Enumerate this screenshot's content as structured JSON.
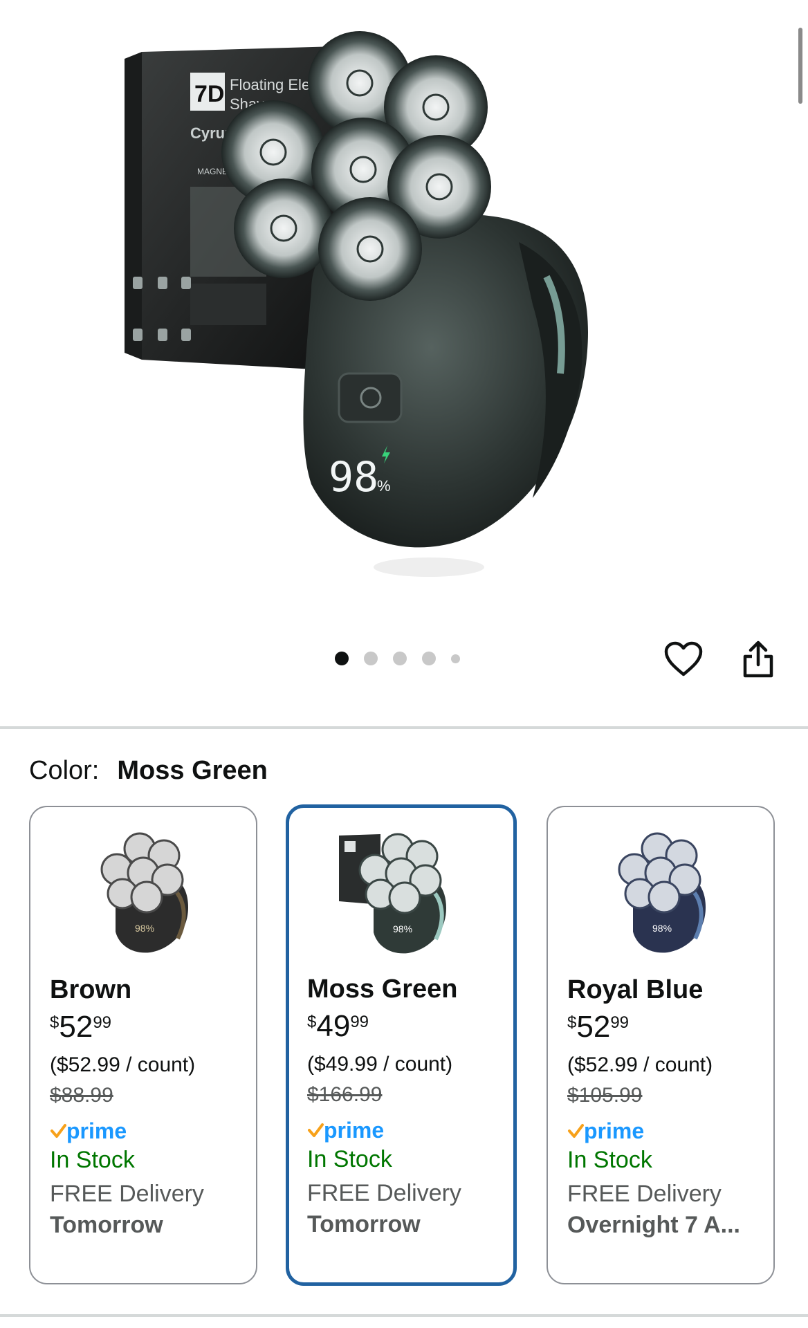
{
  "gallery": {
    "image_count": 5,
    "active_index": 0,
    "product_box_text": "7D Floating Electric Shaver",
    "brand": "Cyruzi",
    "box_feature": "MAGNETIC HEAD",
    "display_readout": "98%"
  },
  "actions": {
    "wishlist_icon": "heart-icon",
    "share_icon": "share-icon"
  },
  "color_selector": {
    "label": "Color:",
    "selected": "Moss Green"
  },
  "variants": [
    {
      "name": "Brown",
      "price_symbol": "$",
      "price_whole": "52",
      "price_fraction": "99",
      "unit_price": "($52.99 / count)",
      "list_price": "$88.99",
      "prime": "prime",
      "availability": "In Stock",
      "delivery": "FREE Delivery",
      "delivery_date": "Tomorrow",
      "body_color": "#2c2c2c",
      "accent_color": "#6b5a3e"
    },
    {
      "name": "Moss Green",
      "price_symbol": "$",
      "price_whole": "49",
      "price_fraction": "99",
      "unit_price": "($49.99 / count)",
      "list_price": "$166.99",
      "prime": "prime",
      "availability": "In Stock",
      "delivery": "FREE Delivery",
      "delivery_date": "Tomorrow",
      "body_color": "#2f3a37",
      "accent_color": "#9cc9c0"
    },
    {
      "name": "Royal Blue",
      "price_symbol": "$",
      "price_whole": "52",
      "price_fraction": "99",
      "unit_price": "($52.99 / count)",
      "list_price": "$105.99",
      "prime": "prime",
      "availability": "In Stock",
      "delivery": "FREE Delivery",
      "delivery_date": "Overnight 7 A...",
      "body_color": "#2a3350",
      "accent_color": "#5d7fb0"
    }
  ],
  "colors": {
    "selected_border": "#2162a1",
    "in_stock": "#007600",
    "prime_blue": "#1a98ff",
    "prime_check": "#f7a11a"
  }
}
